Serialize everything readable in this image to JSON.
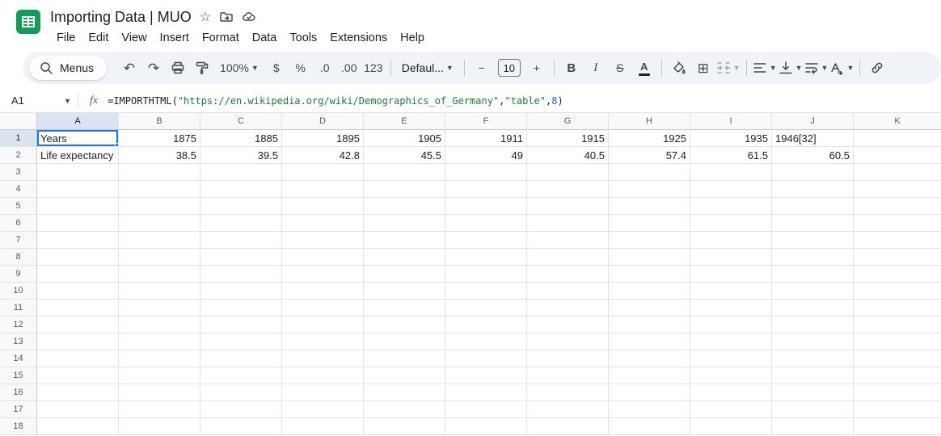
{
  "app": {
    "title": "Importing Data | MUO",
    "menu": [
      "File",
      "Edit",
      "View",
      "Insert",
      "Format",
      "Data",
      "Tools",
      "Extensions",
      "Help"
    ]
  },
  "toolbar": {
    "menus_label": "Menus",
    "zoom_value": "100%",
    "currency_label": "$",
    "percent_label": "%",
    "decrease_decimal_label": ".0",
    "increase_decimal_label": ".00",
    "more_formats_label": "123",
    "font_name": "Defaul...",
    "decrease_font_label": "−",
    "font_size": "10",
    "increase_font_label": "+",
    "bold_label": "B",
    "italic_label": "I",
    "strikethrough_label": "S",
    "text_color_label": "A",
    "undo_glyph": "↶",
    "redo_glyph": "↷",
    "borders_glyph": "⊞"
  },
  "formula_bar": {
    "name_box_value": "A1",
    "fx_label": "fx",
    "formula_tokens": [
      {
        "text": "=IMPORTHTML(",
        "color": "#202124"
      },
      {
        "text": "\"https://en.wikipedia.org/wiki/Demographics_of_Germany\"",
        "color": "#188038"
      },
      {
        "text": ",",
        "color": "#202124"
      },
      {
        "text": "\"table\"",
        "color": "#188038"
      },
      {
        "text": ",",
        "color": "#202124"
      },
      {
        "text": "8",
        "color": "#1967d2"
      },
      {
        "text": ")",
        "color": "#202124"
      }
    ]
  },
  "grid": {
    "columns": [
      "A",
      "B",
      "C",
      "D",
      "E",
      "F",
      "G",
      "H",
      "I",
      "J",
      "K"
    ],
    "visible_rows": 18,
    "selection": "A1",
    "cell_rows": [
      [
        "Years",
        "1875",
        "1885",
        "1895",
        "1905",
        "1911",
        "1915",
        "1925",
        "1935",
        "1946[32]",
        ""
      ],
      [
        "Life expectancy",
        "38.5",
        "39.5",
        "42.8",
        "45.5",
        "49",
        "40.5",
        "57.4",
        "61.5",
        "60.5",
        ""
      ]
    ]
  },
  "colors": {
    "accent_blue": "#1a73e8",
    "sheets_green": "#0f9d58",
    "formula_string_green": "#188038",
    "formula_number_blue": "#1967d2",
    "toolbar_bg": "#f0f4f9",
    "header_highlight": "#dbe3f0"
  }
}
